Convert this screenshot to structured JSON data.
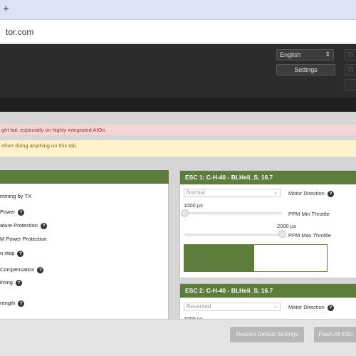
{
  "browser": {
    "new_tab_symbol": "+",
    "url": "tor.com"
  },
  "header": {
    "language": "English",
    "settings_label": "Settings",
    "ghost_labels": [
      "TI",
      "TI",
      ""
    ]
  },
  "warnings": {
    "warning_1": "ght fail, especially on highly integrated AIOs.",
    "warning_2": "efore doing anything on this tab."
  },
  "left_panel": {
    "rows": [
      {
        "label": "mming by TX",
        "help": false
      },
      {
        "label": "Power",
        "help": true
      },
      {
        "label": "ature Protection",
        "help": true
      },
      {
        "label": "M Power Protection",
        "help": false
      },
      {
        "label": "n stop",
        "help": true
      },
      {
        "label": "Compensation",
        "help": true
      },
      {
        "label": "iming",
        "help": true
      },
      {
        "label": "rength",
        "help": true
      }
    ],
    "help_glyph": "?"
  },
  "esc1": {
    "title": "ESC 1: C-H-40 - BLHeli_S, 16.7",
    "direction_value": "Normal",
    "direction_label": "Motor Direction",
    "min_value": "1000 µs",
    "min_label": "PPM Min Throttle",
    "min_level": 0.0,
    "max_value": "2000 µs",
    "max_label": "PPM Max Throttle",
    "max_level": 1.0,
    "bar_fill_fraction": 0.49,
    "help_glyph": "?"
  },
  "esc2": {
    "title": "ESC 2: C-H-40 - BLHeli_S, 16.7",
    "direction_value": "Reversed",
    "direction_label": "Motor Direction",
    "min_value": "1000 µs",
    "help_glyph": "?"
  },
  "footer": {
    "restore_label": "Restore Default Settings",
    "flash_label": "Flash All ESC"
  },
  "colors": {
    "accent_green": "#5e7c3c",
    "header_dark": "#2b2b2b",
    "warning_red_bg": "#f6d4d6",
    "warning_yellow_bg": "#fdf2c9"
  }
}
